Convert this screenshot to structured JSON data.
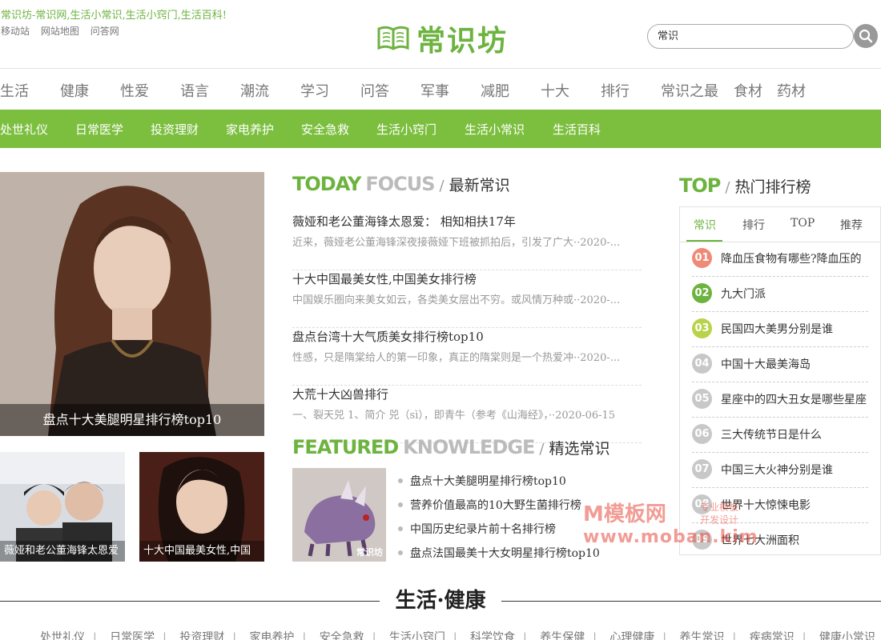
{
  "header": {
    "tagline": "常识坊-常识网,生活小常识,生活小窍门,生活百科!",
    "top_links": [
      "移动站",
      "网站地图",
      "问答网"
    ],
    "logo_text": "常识坊",
    "search_value": "常识"
  },
  "main_nav": [
    "生活",
    "健康",
    "性爱",
    "语言",
    "潮流",
    "学习",
    "问答",
    "军事",
    "减肥",
    "十大",
    "排行",
    "常识之最",
    "食材",
    "药材"
  ],
  "sub_nav": [
    "处世礼仪",
    "日常医学",
    "投资理财",
    "家电养护",
    "安全急救",
    "生活小窍门",
    "生活小常识",
    "生活百科"
  ],
  "hero": {
    "caption": "盘点十大美腿明星排行榜top10",
    "thumbs": [
      "薇娅和老公董海锋太恩爱",
      "十大中国最美女性,中国"
    ]
  },
  "today_focus": {
    "en1": "TODAY",
    "en2": "FOCUS",
    "cn": "最新常识",
    "items": [
      {
        "title": "薇娅和老公董海锋太恩爱： 相知相扶17年",
        "desc": "近来，薇娅老公董海锋深夜接薇娅下班被抓拍后，引发了广大··2020-..."
      },
      {
        "title": "十大中国最美女性,中国美女排行榜",
        "desc": "中国娱乐圈向来美女如云，各类美女层出不穷。或风情万种或··2020-..."
      },
      {
        "title": "盘点台湾十大气质美女排行榜top10",
        "desc": "性感，只是隋棠给人的第一印象，真正的隋棠则是一个热爱冲··2020-..."
      },
      {
        "title": "大荒十大凶兽排行",
        "desc": "一、裂天兕 1、简介 兕（sì），即青牛（参考《山海经》，··2020-06-15"
      }
    ]
  },
  "featured": {
    "en1": "FEATURED",
    "en2": "KNOWLEDGE",
    "cn": "精选常识",
    "image_label": "常识坊",
    "items": [
      "盘点十大美腿明星排行榜top10",
      "营养价值最高的10大野生菌排行榜",
      "中国历史纪录片前十名排行榜",
      "盘点法国最美十大女明星排行榜top10"
    ]
  },
  "top": {
    "en1": "TOP",
    "cn": "热门排行榜",
    "tabs": [
      "常识",
      "排行",
      "TOP",
      "推荐"
    ],
    "items": [
      {
        "num": "01",
        "text": "降血压食物有哪些?降血压的",
        "color": "#ee8a76"
      },
      {
        "num": "02",
        "text": "九大门派",
        "color": "#6db33f"
      },
      {
        "num": "03",
        "text": "民国四大美男分别是谁",
        "color": "#b8d24a"
      },
      {
        "num": "04",
        "text": "中国十大最美海岛",
        "color": "#c8c8c8"
      },
      {
        "num": "05",
        "text": "星座中的四大丑女是哪些星座",
        "color": "#c8c8c8"
      },
      {
        "num": "06",
        "text": "三大传统节日是什么",
        "color": "#c8c8c8"
      },
      {
        "num": "07",
        "text": "中国三大火神分别是谁",
        "color": "#c8c8c8"
      },
      {
        "num": "08",
        "text": "世界十大惊悚电影",
        "color": "#c8c8c8"
      },
      {
        "num": "09",
        "text": "世界七大洲面积",
        "color": "#c8c8c8"
      }
    ]
  },
  "bottom": {
    "title": "生活·健康",
    "links": [
      "处世礼仪",
      "日常医学",
      "投资理财",
      "家电养护",
      "安全急救",
      "生活小窍门",
      "科学饮食",
      "养生保健",
      "心理健康",
      "养生常识",
      "疾病常识",
      "健康小常识"
    ]
  },
  "watermark": {
    "line1": "M模板网",
    "line2": "www.moban.kim",
    "sub1": "专业模板",
    "sub2": "开发设计"
  }
}
